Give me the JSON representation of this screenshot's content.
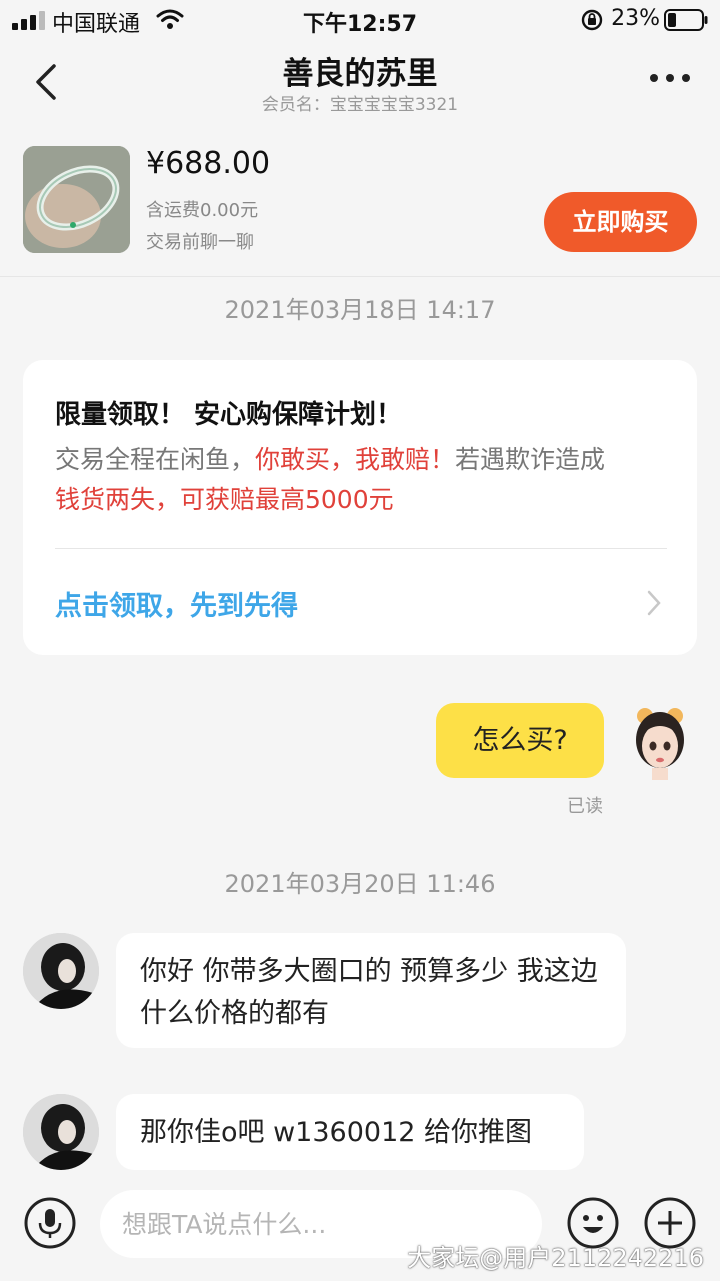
{
  "status_bar": {
    "carrier": "中国联通",
    "time": "下午12:57",
    "battery": "23%"
  },
  "header": {
    "title": "善良的苏里",
    "member_label": "会员名：宝宝宝宝宝3321"
  },
  "product": {
    "price": "¥688.00",
    "shipping": "含运费0.00元",
    "note": "交易前聊一聊",
    "buy_button": "立即购买"
  },
  "messages": {
    "timestamp_1": "2021年03月18日 14:17",
    "card": {
      "title": "限量领取！ 安心购保障计划！",
      "body_part1": "交易全程在闲鱼，",
      "body_red1": "你敢买，我敢赔！",
      "body_part2": "若遇欺诈造成",
      "body_red2": "钱货两失，可获赔最高5000元",
      "link": "点击领取，先到先得"
    },
    "outgoing_1": "怎么买?",
    "read_status": "已读",
    "timestamp_2": "2021年03月20日 11:46",
    "incoming_1": "你好 你带多大圈口的 预算多少 我这边什么价格的都有",
    "incoming_2": "那你佳o吧 w1360012 给你推图"
  },
  "input": {
    "placeholder": "想跟TA说点什么..."
  },
  "watermark": "大家坛@用户2112242216",
  "colors": {
    "accent": "#f05a2a",
    "bubble_out": "#fde047",
    "link_blue": "#3ea6e8",
    "warning_red": "#e0413a"
  }
}
